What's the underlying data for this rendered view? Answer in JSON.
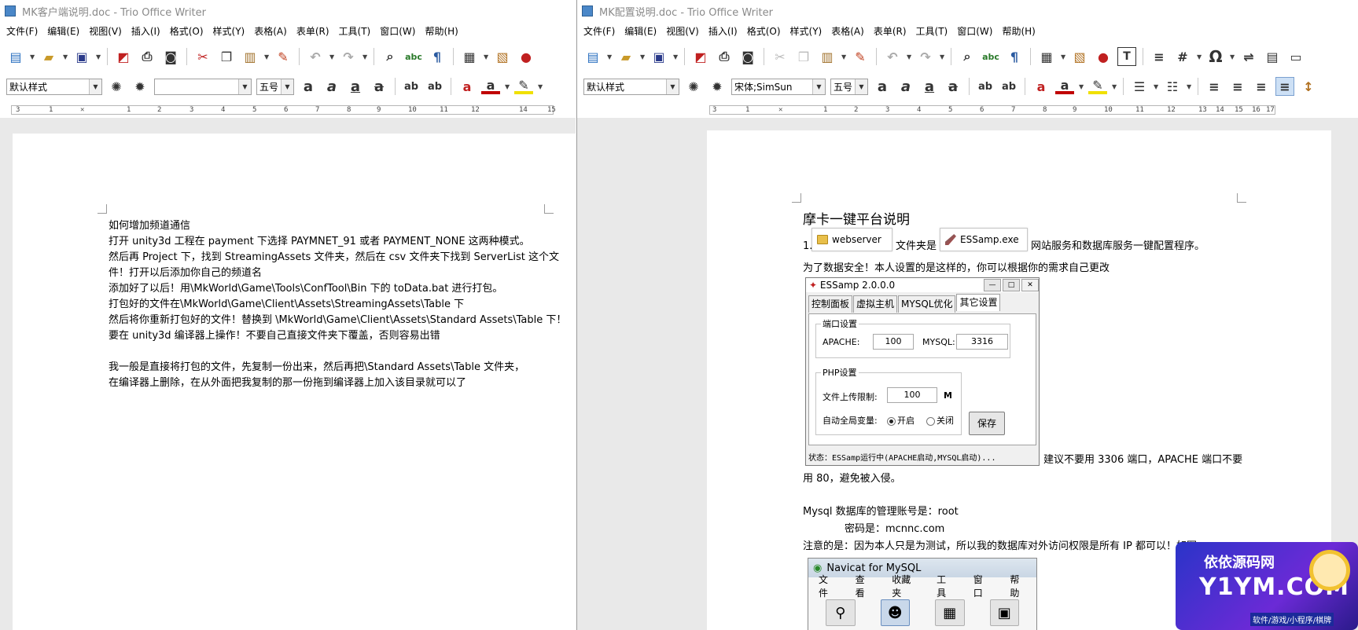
{
  "window1": {
    "title": "MK客户端说明.doc - Trio Office Writer",
    "menu": [
      "文件(F)",
      "编辑(E)",
      "视图(V)",
      "插入(I)",
      "格式(O)",
      "样式(Y)",
      "表格(A)",
      "表单(R)",
      "工具(T)",
      "窗口(W)",
      "帮助(H)"
    ],
    "style_combo": "默认样式",
    "font_combo": "",
    "size_combo": "五号",
    "ruler_ticks": [
      "3",
      "1",
      "1",
      "2",
      "3",
      "4",
      "5",
      "6",
      "7",
      "8",
      "9",
      "10",
      "11",
      "12",
      "14",
      "15"
    ],
    "lines": [
      "如何增加频道通信",
      "打开 unity3d 工程在 payment 下选择 PAYMNET_91 或者 PAYMENT_NONE 这两种模式。",
      "然后再 Project 下，找到 StreamingAssets 文件夹，然后在 csv 文件夹下找到 ServerList 这个文",
      "件！打开以后添加你自己的频道名",
      "添加好了以后！用\\MkWorld\\Game\\Tools\\ConfTool\\Bin 下的 toData.bat 进行打包。",
      "打包好的文件在\\MkWorld\\Game\\Client\\Assets\\StreamingAssets\\Table 下",
      "然后将你重新打包好的文件！替换到 \\MkWorld\\Game\\Client\\Assets\\Standard Assets\\Table 下！",
      "要在 unity3d 编译器上操作！不要自己直接文件夹下覆盖，否则容易出错",
      "",
      "我一般是直接将打包的文件，先复制一份出来，然后再把\\Standard Assets\\Table 文件夹，",
      "在编译器上删除，在从外面把我复制的那一份拖到编译器上加入该目录就可以了"
    ]
  },
  "window2": {
    "title": "MK配置说明.doc - Trio Office Writer",
    "menu": [
      "文件(F)",
      "编辑(E)",
      "视图(V)",
      "插入(I)",
      "格式(O)",
      "样式(Y)",
      "表格(A)",
      "表单(R)",
      "工具(T)",
      "窗口(W)",
      "帮助(H)"
    ],
    "style_combo": "默认样式",
    "font_combo": "宋体;SimSun",
    "size_combo": "五号",
    "ruler_ticks": [
      "3",
      "1",
      "1",
      "2",
      "3",
      "4",
      "5",
      "6",
      "7",
      "8",
      "9",
      "10",
      "11",
      "12",
      "13",
      "14",
      "15",
      "16",
      "17"
    ],
    "doc": {
      "heading": "摩卡一键平台说明",
      "line1_prefix": "1.",
      "chip_webserver": "webserver",
      "line1_mid": "文件夹是",
      "chip_essamp": "ESSamp.exe",
      "line1_suffix": "网站服务和数据库服务一键配置程序。",
      "line2": "为了数据安全！本人设置的是这样的，你可以根据你的需求自己更改",
      "line3_tail": "建议不要用 3306 端口，APACHE 端口不要",
      "line4": "用 80，避免被入侵。",
      "line5": "Mysql 数据库的管理账号是：root",
      "line6": "密码是：mcnnc.com",
      "line7": "注意的是：因为本人只是为测试，所以我的数据库对外访问权限是所有 IP 都可以！如图"
    },
    "essamp": {
      "title": "ESSamp 2.0.0.0",
      "tabs": [
        "控制面板",
        "虚拟主机",
        "MYSQL优化",
        "其它设置"
      ],
      "port_group": "端口设置",
      "apache_label": "APACHE:",
      "apache_value": "100",
      "mysql_label": "MYSQL:",
      "mysql_value": "3316",
      "php_group": "PHP设置",
      "upload_label": "文件上传限制:",
      "upload_value": "100",
      "upload_unit": "M",
      "globals_label": "自动全局变量:",
      "opt_on": "开启",
      "opt_off": "关闭",
      "save": "保存",
      "status": "状态：ESSamp运行中(APACHE启动,MYSQL启动)..."
    },
    "navicat": {
      "title": "Navicat for MySQL",
      "menu": [
        "文件",
        "查看",
        "收藏夹",
        "工具",
        "窗口",
        "帮助"
      ]
    }
  },
  "watermark": {
    "line1": "依依源码网",
    "line2": "Y1YM.COM",
    "line3": "软件/游戏/小程序/棋牌"
  }
}
